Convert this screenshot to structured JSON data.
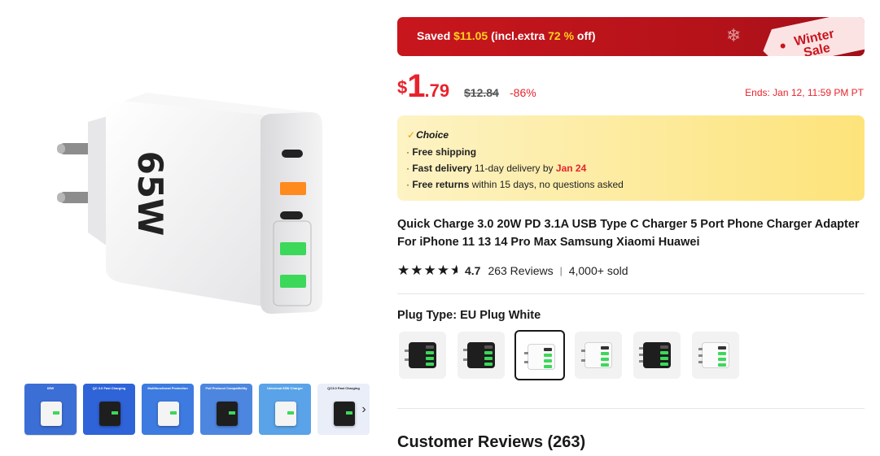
{
  "sale_banner": {
    "saved_prefix": "Saved ",
    "saved_amount": "$11.05",
    "mid_text": " (incl.extra ",
    "extra_percent": "72 %",
    "suffix": " off)",
    "tag_text": "Winter Sale"
  },
  "price": {
    "currency": "$",
    "integer": "1",
    "decimal": ".79",
    "original": "$12.84",
    "discount": "-86%",
    "ends": "Ends: Jan 12, 11:59 PM PT"
  },
  "choice": {
    "title": "Choice",
    "free_shipping": "Free shipping",
    "fast_delivery_label": "Fast delivery",
    "fast_delivery_text": " 11-day delivery by ",
    "fast_delivery_date": "Jan 24",
    "free_returns_label": "Free returns",
    "free_returns_text": "  within 15 days, no questions asked"
  },
  "product": {
    "title": "Quick Charge 3.0 20W PD 3.1A USB Type C Charger 5 Port Phone Charger Adapter For iPhone 11 13 14 Pro Max Samsung Xiaomi Huawei",
    "rating_value": 4.7,
    "rating_text": "4.7",
    "reviews": "263 Reviews",
    "sold": "4,000+ sold"
  },
  "gallery": {
    "main_image_label": "65W",
    "thumbnails": [
      {
        "label": "65W",
        "theme": "#3c6fd6"
      },
      {
        "label": "QC 3.0 Fast Charging",
        "theme": "#2f63d8"
      },
      {
        "label": "Multifunctional Protection",
        "theme": "#3d7be0"
      },
      {
        "label": "Full Protocol Compatibility",
        "theme": "#4d86df"
      },
      {
        "label": "Universal 65W Charger",
        "theme": "#5aa3e8"
      },
      {
        "label": "QC3.0 Fast Charging",
        "theme": "#e9eef8"
      }
    ]
  },
  "plug_type": {
    "label_prefix": "Plug Type: ",
    "selected": "EU Plug White",
    "variants": [
      {
        "name": "variant-eu-black",
        "color": "black",
        "plug": "eu"
      },
      {
        "name": "variant-us-black",
        "color": "black",
        "plug": "us"
      },
      {
        "name": "variant-eu-white",
        "color": "white",
        "plug": "eu",
        "selected": true
      },
      {
        "name": "variant-us-white",
        "color": "white",
        "plug": "us"
      },
      {
        "name": "variant-uk-black",
        "color": "black",
        "plug": "uk"
      },
      {
        "name": "variant-uk-white",
        "color": "white",
        "plug": "uk"
      }
    ]
  },
  "reviews_section": {
    "heading": "Customer Reviews (263)"
  },
  "colors": {
    "accent_red": "#e8232d",
    "banner_red": "#c8161d",
    "banner_highlight": "#ffd21f",
    "choice_yellow": "#fde37a",
    "port_green": "#3cd85a",
    "port_orange": "#ff8a1e"
  }
}
